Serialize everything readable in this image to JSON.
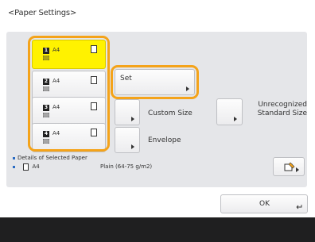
{
  "header": {
    "title": "<Paper Settings>"
  },
  "drawers": [
    {
      "number": "1",
      "size": "A4",
      "selected": true
    },
    {
      "number": "2",
      "size": "A4",
      "selected": false
    },
    {
      "number": "3",
      "size": "A4",
      "selected": false
    },
    {
      "number": "4",
      "size": "A4",
      "selected": false
    }
  ],
  "buttons": {
    "set": "Set",
    "custom_size": "Custom Size",
    "envelope": "Envelope",
    "unrecognized": "Unrecognized Standard Size",
    "ok": "OK"
  },
  "details": {
    "label": "Details of Selected Paper",
    "paper_size": "A4",
    "paper_type": "Plain (64-75 g/m2)"
  },
  "colors": {
    "selected_drawer": "#fff200",
    "selection_outline": "#f4a31a",
    "bottom_bar": "#1f1f20"
  }
}
